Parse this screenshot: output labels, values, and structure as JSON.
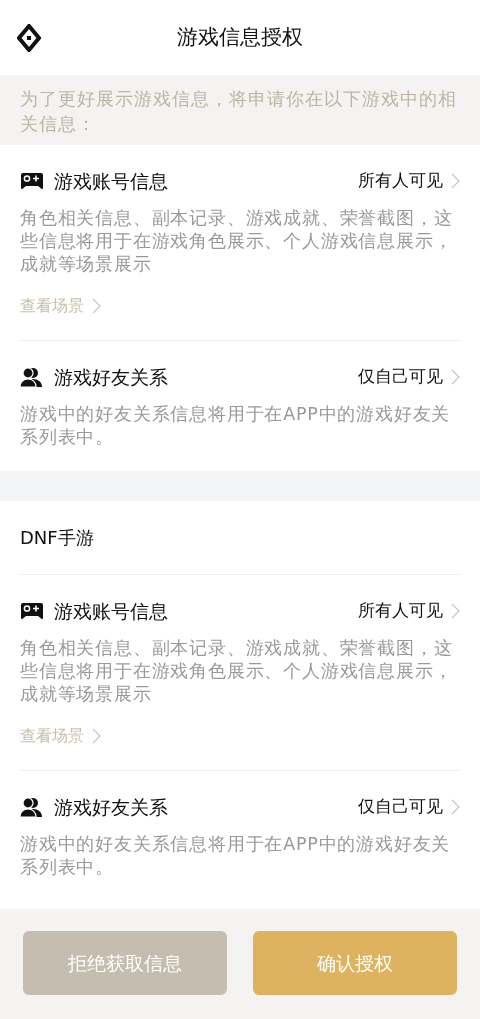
{
  "header": {
    "title": "游戏信息授权"
  },
  "intro": "为了更好展示游戏信息，将申请你在以下游戏中的相关信息：",
  "sections": [
    {
      "items": [
        {
          "kind": "account",
          "title": "游戏账号信息",
          "visibility": "所有人可见",
          "description": "角色相关信息、副本记录、游戏成就、荣誉截图，这些信息将用于在游戏角色展示、个人游戏信息展示，成就等场景展示",
          "link": "查看场景"
        },
        {
          "kind": "friends",
          "title": "游戏好友关系",
          "visibility": "仅自己可见",
          "description": "游戏中的好友关系信息将用于在APP中的游戏好友关系列表中。"
        }
      ]
    },
    {
      "game": "DNF手游",
      "items": [
        {
          "kind": "account",
          "title": "游戏账号信息",
          "visibility": "所有人可见",
          "description": "角色相关信息、副本记录、游戏成就、荣誉截图，这些信息将用于在游戏角色展示、个人游戏信息展示，成就等场景展示",
          "link": "查看场景"
        },
        {
          "kind": "friends",
          "title": "游戏好友关系",
          "visibility": "仅自己可见",
          "description": "游戏中的好友关系信息将用于在APP中的游戏好友关系列表中。"
        }
      ]
    }
  ],
  "buttons": [
    {
      "kind": "reject",
      "label": "拒绝获取信息"
    },
    {
      "kind": "confirm",
      "label": "确认授权"
    }
  ]
}
